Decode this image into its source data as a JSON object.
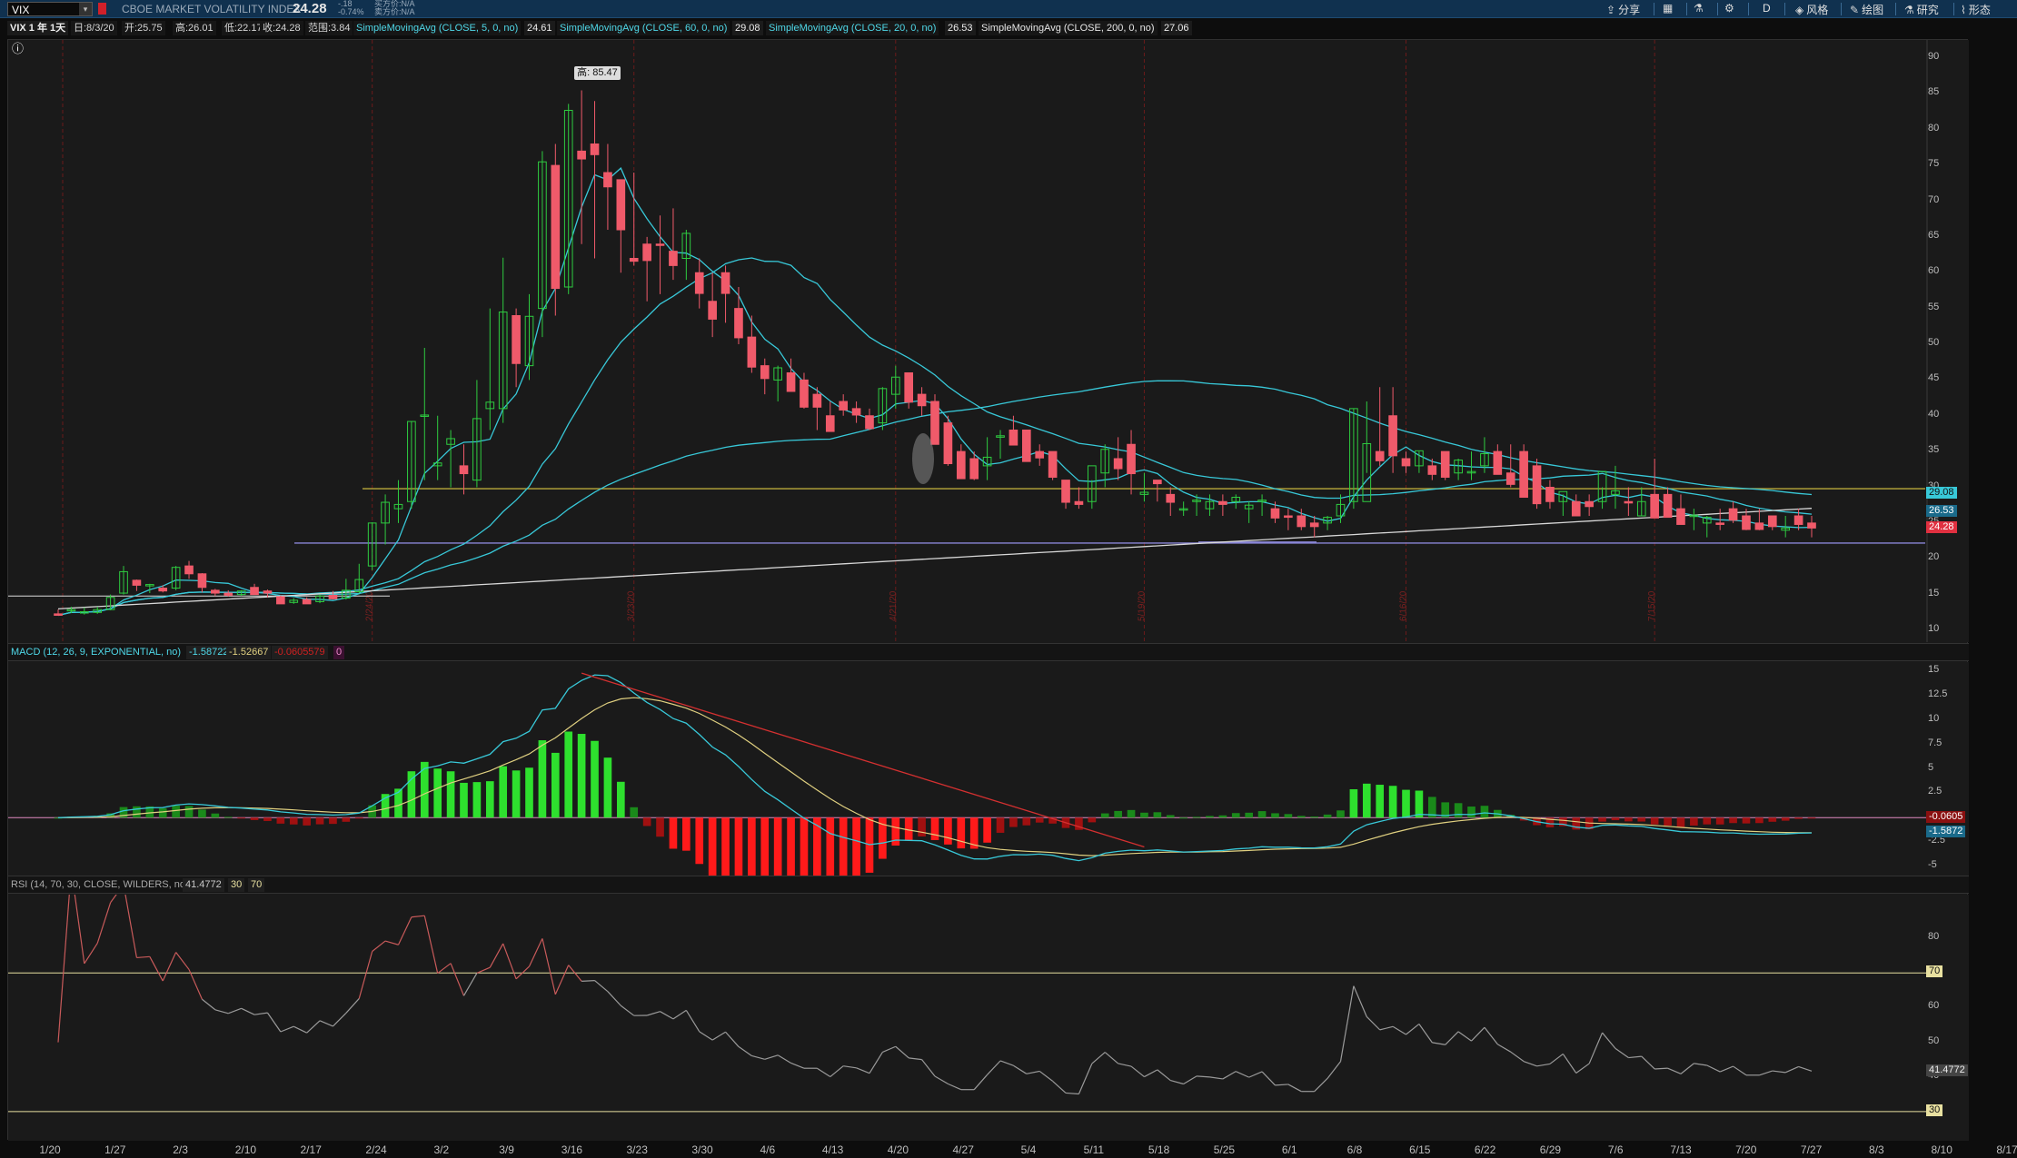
{
  "top": {
    "symbol": "VIX",
    "name": "CBOE MARKET VOLATILITY INDEX",
    "last": "24.28",
    "change": "-.18",
    "change_pct": "-0.74%",
    "bid": "买方价:N/A",
    "ask": "卖方价:N/A",
    "share": "分享",
    "style": "风格",
    "draw": "绘图",
    "study": "研究",
    "pattern": "形态",
    "d_label": "D"
  },
  "info": {
    "interval": "VIX 1 年 1天",
    "date": "日:8/3/20",
    "open": "开:25.75",
    "high": "高:26.01",
    "low": "低:22.17",
    "close": "收:24.28",
    "range": "范围:3.84",
    "sma1": "SimpleMovingAvg (CLOSE, 5, 0, no)",
    "sma1v": "24.61",
    "sma2": "SimpleMovingAvg (CLOSE, 60, 0, no)",
    "sma2v": "29.08",
    "sma3": "SimpleMovingAvg (CLOSE, 20, 0, no)",
    "sma3v": "26.53",
    "sma4": "SimpleMovingAvg (CLOSE, 200, 0, no)",
    "sma4v": "27.06"
  },
  "macd_bar": {
    "label": "MACD (12, 26, 9, EXPONENTIAL, no)",
    "v1": "-1.58722",
    "v2": "-1.52667",
    "v3": "-0.0605579",
    "v4": "0"
  },
  "rsi_bar": {
    "label": "RSI (14, 70, 30, CLOSE, WILDERS, no)",
    "v1": "41.4772",
    "v2": "30",
    "v3": "70"
  },
  "high_tag": "高: 85.47",
  "price_axis": [
    "90",
    "85",
    "80",
    "75",
    "70",
    "65",
    "60",
    "55",
    "50",
    "45",
    "40",
    "35",
    "30",
    "25",
    "20",
    "15",
    "10"
  ],
  "macd_axis": [
    "15",
    "12.5",
    "10",
    "7.5",
    "5",
    "2.5",
    "0",
    "-2.5",
    "-5"
  ],
  "rsi_axis": [
    "80",
    "70",
    "60",
    "50",
    "40",
    "30"
  ],
  "price_tags": {
    "sma60": "29.08",
    "sma20": "26.53",
    "last": "24.28"
  },
  "macd_tags": {
    "hist": "-0.0605",
    "macd": "-1.5872"
  },
  "rsi_tags": {
    "level70": "70",
    "rsi": "41.4772",
    "level30": "30"
  },
  "month_labels": [
    "2/24/20",
    "3/23/20",
    "4/21/20",
    "5/19/20",
    "6/16/20",
    "7/15/20"
  ],
  "x_labels": [
    "1/20",
    "1/27",
    "2/3",
    "2/10",
    "2/17",
    "2/24",
    "3/2",
    "3/9",
    "3/16",
    "3/23",
    "3/30",
    "4/6",
    "4/13",
    "4/20",
    "4/27",
    "5/4",
    "5/11",
    "5/18",
    "5/25",
    "6/1",
    "6/8",
    "6/15",
    "6/22",
    "6/29",
    "7/6",
    "7/13",
    "7/20",
    "7/27",
    "8/3",
    "8/10",
    "8/17"
  ],
  "colors": {
    "up": "#2ecc40",
    "down": "#f05a6a",
    "sma": "#38c8d8",
    "sma200": "#d8d8d8",
    "level": "#b9a93a",
    "support": "#8a86d8",
    "rsi": "#9a9a9a",
    "macd": "#38c8d8",
    "signal": "#e0d080"
  },
  "chart_data": {
    "type": "candlestick",
    "title": "CBOE MARKET VOLATILITY INDEX",
    "x": [
      "1/17",
      "1/21",
      "1/22",
      "1/23",
      "1/24",
      "1/27",
      "1/28",
      "1/29",
      "1/30",
      "1/31",
      "2/3",
      "2/4",
      "2/5",
      "2/6",
      "2/7",
      "2/10",
      "2/11",
      "2/12",
      "2/13",
      "2/14",
      "2/18",
      "2/19",
      "2/20",
      "2/21",
      "2/24",
      "2/25",
      "2/26",
      "2/27",
      "2/28",
      "3/2",
      "3/3",
      "3/4",
      "3/5",
      "3/6",
      "3/9",
      "3/10",
      "3/11",
      "3/12",
      "3/13",
      "3/16",
      "3/17",
      "3/18",
      "3/19",
      "3/20",
      "3/23",
      "3/24",
      "3/25",
      "3/26",
      "3/27",
      "3/30",
      "3/31",
      "4/1",
      "4/2",
      "4/3",
      "4/6",
      "4/7",
      "4/8",
      "4/9",
      "4/13",
      "4/14",
      "4/15",
      "4/16",
      "4/17",
      "4/20",
      "4/21",
      "4/22",
      "4/23",
      "4/24",
      "4/27",
      "4/28",
      "4/29",
      "4/30",
      "5/1",
      "5/4",
      "5/5",
      "5/6",
      "5/7",
      "5/8",
      "5/11",
      "5/12",
      "5/13",
      "5/14",
      "5/15",
      "5/18",
      "5/19",
      "5/20",
      "5/21",
      "5/22",
      "5/26",
      "5/27",
      "5/28",
      "5/29",
      "6/1",
      "6/2",
      "6/3",
      "6/4",
      "6/5",
      "6/8",
      "6/9",
      "6/10",
      "6/11",
      "6/12",
      "6/15",
      "6/16",
      "6/17",
      "6/18",
      "6/19",
      "6/22",
      "6/23",
      "6/24",
      "6/25",
      "6/26",
      "6/29",
      "6/30",
      "7/1",
      "7/2",
      "7/6",
      "7/7",
      "7/8",
      "7/9",
      "7/10",
      "7/13",
      "7/14",
      "7/15",
      "7/16",
      "7/17",
      "7/20",
      "7/21",
      "7/22",
      "7/23",
      "7/24",
      "7/27",
      "7/28",
      "7/29",
      "7/30",
      "7/31",
      "8/3"
    ],
    "open": [
      12.3,
      12.8,
      12.6,
      12.5,
      12.9,
      15.2,
      17.0,
      16.3,
      15.9,
      15.9,
      19.0,
      17.9,
      15.6,
      15.2,
      15.0,
      16.0,
      15.5,
      14.7,
      13.9,
      14.3,
      14.0,
      14.9,
      14.5,
      15.4,
      19.0,
      25.0,
      27.0,
      28.0,
      40.0,
      33.0,
      36.0,
      33.0,
      31.0,
      41.0,
      41.0,
      54.0,
      47.0,
      55.0,
      75.0,
      58.0,
      77.0,
      78.0,
      74.0,
      73.0,
      62.0,
      64.0,
      64.0,
      63.0,
      62.0,
      60.0,
      56.0,
      60.0,
      55.0,
      51.0,
      47.0,
      45.0,
      46.0,
      45.0,
      43.0,
      40.0,
      42.0,
      41.0,
      40.0,
      39.0,
      43.0,
      46.0,
      43.0,
      42.0,
      39.0,
      35.0,
      34.0,
      33.0,
      37.0,
      38.0,
      38.0,
      35.0,
      35.0,
      31.0,
      28.0,
      28.0,
      32.0,
      34.0,
      36.0,
      29.0,
      31.0,
      29.0,
      27.0,
      28.0,
      27.0,
      28.0,
      28.0,
      27.0,
      28.0,
      27.0,
      26.0,
      26.0,
      25.0,
      25.0,
      26.0,
      28.0,
      28.0,
      35.0,
      40.0,
      34.0,
      33.0,
      33.0,
      35.0,
      32.0,
      32.0,
      33.0,
      35.0,
      32.0,
      35.0,
      33.0,
      30.0,
      28.0,
      28.0,
      28.0,
      28.0,
      29.0,
      28.0,
      26.0,
      29.0,
      29.0,
      27.0,
      26.0,
      25.0,
      25.0,
      27.0,
      26.0,
      25.0,
      26.0,
      24.0,
      26.0,
      25.0,
      25.0
    ],
    "high": [
      12.9,
      13.3,
      13.2,
      13.3,
      15.0,
      19.0,
      17.1,
      16.5,
      16.3,
      19.0,
      19.7,
      18.0,
      15.8,
      15.6,
      15.6,
      16.5,
      15.7,
      14.9,
      14.5,
      14.6,
      15.0,
      15.5,
      17.2,
      19.3,
      25.1,
      29.0,
      31.0,
      39.2,
      49.5,
      40.0,
      38.0,
      36.0,
      45.0,
      55.0,
      62.1,
      55.0,
      57.0,
      77.0,
      78.0,
      83.6,
      85.5,
      84.0,
      78.0,
      73.0,
      74.0,
      65.0,
      68.0,
      69.0,
      66.0,
      62.0,
      60.0,
      61.0,
      58.0,
      54.0,
      48.0,
      47.0,
      48.0,
      46.0,
      44.0,
      42.0,
      43.0,
      42.0,
      41.0,
      44.0,
      47.0,
      46.0,
      44.0,
      43.0,
      40.0,
      36.0,
      35.0,
      37.0,
      38.0,
      40.0,
      38.0,
      36.0,
      35.0,
      31.0,
      30.0,
      31.0,
      36.0,
      37.0,
      38.0,
      32.0,
      31.0,
      30.0,
      28.0,
      29.0,
      29.0,
      29.0,
      29.0,
      28.0,
      29.0,
      28.0,
      27.0,
      27.0,
      26.0,
      26.0,
      29.0,
      41.0,
      42.0,
      44.0,
      44.0,
      35.0,
      35.0,
      34.0,
      35.0,
      34.0,
      35.0,
      37.0,
      36.0,
      36.0,
      36.0,
      34.0,
      31.0,
      29.0,
      29.0,
      29.0,
      30.0,
      33.0,
      30.0,
      30.0,
      34.0,
      30.0,
      29.0,
      27.0,
      26.0,
      27.0,
      28.0,
      27.0,
      27.0,
      26.0,
      26.0,
      27.0,
      26.0,
      26.0
    ],
    "low": [
      12.1,
      12.4,
      12.2,
      12.3,
      12.8,
      15.0,
      15.5,
      15.2,
      15.3,
      15.6,
      17.2,
      15.3,
      14.8,
      14.7,
      14.8,
      15.2,
      14.6,
      13.8,
      13.7,
      13.9,
      13.8,
      14.3,
      14.3,
      15.2,
      18.4,
      22.0,
      25.0,
      27.0,
      31.0,
      31.0,
      30.0,
      29.0,
      30.0,
      38.0,
      39.0,
      44.0,
      45.0,
      51.0,
      54.0,
      57.0,
      64.0,
      62.0,
      66.0,
      60.0,
      61.0,
      56.0,
      57.0,
      59.0,
      59.0,
      55.0,
      51.0,
      53.0,
      50.0,
      46.0,
      43.0,
      42.0,
      44.0,
      41.0,
      38.0,
      38.0,
      40.0,
      39.0,
      38.0,
      38.0,
      41.0,
      41.0,
      40.0,
      38.0,
      33.0,
      32.0,
      31.0,
      31.0,
      34.0,
      36.0,
      34.0,
      33.0,
      31.0,
      27.0,
      27.0,
      27.0,
      30.0,
      31.0,
      29.0,
      28.0,
      28.0,
      26.0,
      26.0,
      26.0,
      26.0,
      26.0,
      27.0,
      25.0,
      26.0,
      25.0,
      24.0,
      24.0,
      23.0,
      24.0,
      25.0,
      27.0,
      32.0,
      33.0,
      32.0,
      32.0,
      32.0,
      31.0,
      31.0,
      31.0,
      31.0,
      32.0,
      32.0,
      30.0,
      31.0,
      27.0,
      27.0,
      26.0,
      26.0,
      26.0,
      27.0,
      27.0,
      26.0,
      26.0,
      27.0,
      27.0,
      25.0,
      24.0,
      23.0,
      24.0,
      25.0,
      24.0,
      24.0,
      24.0,
      23.0,
      24.0,
      23.0,
      22.0
    ],
    "close": [
      12.1,
      12.9,
      12.6,
      12.9,
      14.6,
      18.2,
      16.3,
      16.4,
      15.5,
      18.8,
      17.9,
      16.0,
      15.2,
      14.9,
      15.5,
      15.0,
      15.2,
      13.7,
      14.2,
      13.7,
      14.8,
      14.4,
      15.6,
      17.1,
      25.0,
      27.9,
      27.6,
      39.2,
      40.1,
      33.4,
      36.8,
      31.9,
      39.6,
      41.9,
      54.5,
      47.3,
      53.9,
      75.5,
      57.8,
      82.7,
      75.9,
      76.5,
      72.0,
      66.0,
      61.6,
      61.7,
      63.9,
      61.0,
      65.5,
      57.1,
      53.5,
      57.1,
      50.9,
      46.8,
      45.2,
      46.7,
      43.4,
      41.2,
      41.2,
      37.8,
      40.8,
      40.1,
      38.2,
      43.8,
      45.4,
      41.9,
      41.4,
      36.0,
      33.3,
      31.2,
      31.2,
      34.2,
      37.2,
      35.9,
      33.6,
      34.1,
      31.4,
      27.9,
      27.6,
      33.0,
      35.3,
      32.6,
      31.9,
      29.3,
      30.5,
      27.9,
      27.0,
      28.2,
      28.0,
      27.6,
      28.6,
      27.5,
      28.2,
      25.7,
      25.8,
      24.5,
      24.5,
      25.8,
      27.6,
      41.0,
      36.1,
      33.7,
      34.4,
      33.0,
      35.1,
      31.8,
      31.4,
      33.8,
      32.2,
      34.7,
      31.8,
      30.4,
      28.6,
      27.7,
      28.0,
      29.4,
      26.0,
      27.3,
      32.2,
      29.5,
      27.8,
      28.0,
      25.7,
      25.8,
      24.8,
      26.1,
      25.8,
      24.8,
      25.4,
      24.1,
      24.1,
      24.5,
      24.3,
      24.8,
      24.3
    ]
  }
}
